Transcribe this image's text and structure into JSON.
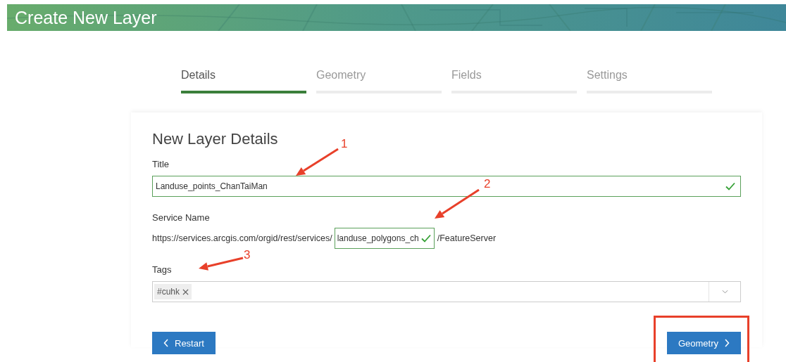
{
  "header": {
    "title": "Create New Layer"
  },
  "tabs": [
    {
      "label": "Details",
      "selected": true
    },
    {
      "label": "Geometry",
      "selected": false
    },
    {
      "label": "Fields",
      "selected": false
    },
    {
      "label": "Settings",
      "selected": false
    }
  ],
  "form": {
    "heading": "New Layer Details",
    "title_field": {
      "label": "Title",
      "value": "Landuse_points_ChanTaiMan",
      "valid": true
    },
    "service_name": {
      "label": "Service Name",
      "prefix": "https://services.arcgis.com/orgid/rest/services/",
      "value": "landuse_polygons_ch",
      "valid": true,
      "suffix": "/FeatureServer"
    },
    "tags": {
      "label": "Tags",
      "items": [
        "#cuhk"
      ]
    },
    "buttons": [
      {
        "label": "Restart",
        "kind": "back"
      },
      {
        "label": "Geometry",
        "kind": "next"
      }
    ]
  },
  "annotations": [
    {
      "kind": "arrow",
      "label": "1"
    },
    {
      "kind": "arrow",
      "label": "2"
    },
    {
      "kind": "arrow",
      "label": "3"
    },
    {
      "kind": "box"
    }
  ]
}
